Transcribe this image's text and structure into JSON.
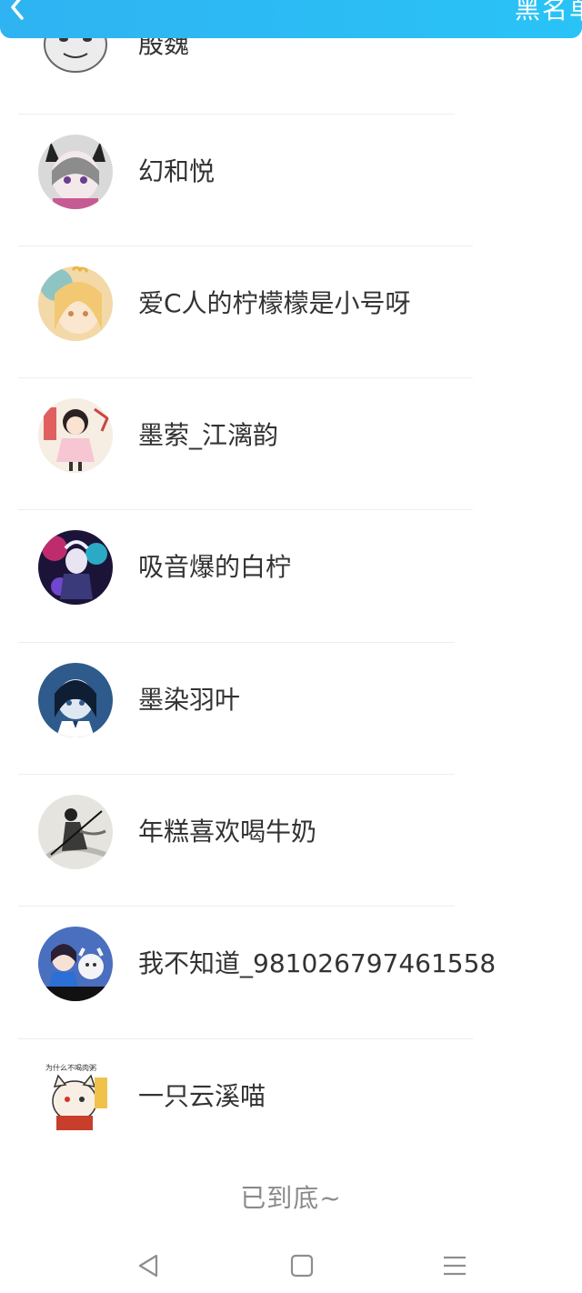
{
  "header": {
    "title": "黑名单",
    "back_icon": "chevron-left-icon",
    "background": "#2fb3f2"
  },
  "blacklist": {
    "items": [
      {
        "name": "殷魏",
        "avatar_icon": "meme-face-avatar"
      },
      {
        "name": "幻和悦",
        "avatar_icon": "cat-ear-girl-avatar"
      },
      {
        "name": "爱C人的柠檬檬是小号呀",
        "avatar_icon": "blonde-girl-avatar"
      },
      {
        "name": "墨萦_江漓韵",
        "avatar_icon": "chibi-girl-avatar"
      },
      {
        "name": "吸音爆的白柠",
        "avatar_icon": "neon-idol-avatar"
      },
      {
        "name": "墨染羽叶",
        "avatar_icon": "blue-anime-avatar"
      },
      {
        "name": "年糕喜欢喝牛奶",
        "avatar_icon": "ink-swordsman-avatar"
      },
      {
        "name": "我不知道_981026797461558",
        "avatar_icon": "anime-duo-avatar"
      },
      {
        "name": "一只云溪喵",
        "avatar_icon": "meme-cat-avatar"
      }
    ]
  },
  "footer": {
    "end_text": "已到底~"
  },
  "nav": {
    "back": "triangle-back-icon",
    "home": "square-home-icon",
    "menu": "three-line-menu-icon"
  }
}
